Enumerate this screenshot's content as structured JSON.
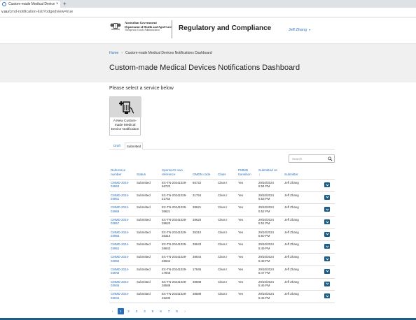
{
  "browser": {
    "tab_title": "Custom-made Medical Devices N",
    "tab_close": "×",
    "new_tab": "+",
    "url_prefix": "v.au",
    "url_path": "/cmd-notification-list/?odgedview=true"
  },
  "header": {
    "gov_line1": "Australian Government",
    "gov_line2": "Department of Health and Aged Care",
    "gov_line3": "Therapeutic Goods Administration",
    "site_title": "Regulatory and Compliance",
    "user_name": "Jeff Zhang",
    "user_caret": "▾"
  },
  "breadcrumb": {
    "home": "Home",
    "separator": "›",
    "current": "Custom-made Medical Devices Notifications Dashboard"
  },
  "page_title": "Custom-made Medical Devices Notifications Dashboard",
  "service": {
    "heading": "Please select a service below",
    "tile_label": "A New Custom-made Medical Device Notification"
  },
  "tabs": {
    "draft": "Draft",
    "submitted": "Submitted",
    "active": "Submitted"
  },
  "search": {
    "placeholder": "Search"
  },
  "table": {
    "headers": {
      "reference": "Reference number",
      "status": "Status",
      "sponsor_ref": "Sponsor's own reference",
      "gmdn": "GMDN code",
      "class": "Class",
      "pmmd": "PMMD transition",
      "submitted": "Submitted on",
      "sort_arrow": "↓",
      "submitter": "Submitter"
    },
    "rows": [
      {
        "ref_a": "CMMD-2024-",
        "ref_b": "03963",
        "status": "Submitted",
        "spon_a": "EX-TN-20241029-",
        "spon_b": "66722",
        "gmdn": "66722",
        "class": "Class I",
        "pmmd": "Yes",
        "date": "29/10/2024",
        "time": "5:54 PM",
        "submitter": "Jeff Zhang"
      },
      {
        "ref_a": "CMMD-2024-",
        "ref_b": "03961",
        "status": "Submitted",
        "spon_a": "EX-TN-20241029-",
        "spon_b": "31754",
        "gmdn": "31754",
        "class": "Class I",
        "pmmd": "Yes",
        "date": "29/10/2024",
        "time": "5:53 PM",
        "submitter": "Jeff Zhang"
      },
      {
        "ref_a": "CMMD-2024-",
        "ref_b": "03959",
        "status": "Submitted",
        "spon_a": "EX-TN-20241029-",
        "spon_b": "38621",
        "gmdn": "38621",
        "class": "Class I",
        "pmmd": "Yes",
        "date": "29/10/2024",
        "time": "5:52 PM",
        "submitter": "Jeff Zhang"
      },
      {
        "ref_a": "CMMD-2024-",
        "ref_b": "03957",
        "status": "Submitted",
        "spon_a": "EX-TN-20241029-",
        "spon_b": "38620",
        "gmdn": "38620",
        "class": "Class I",
        "pmmd": "Yes",
        "date": "29/10/2024",
        "time": "5:51 PM",
        "submitter": "Jeff Zhang"
      },
      {
        "ref_a": "CMMD-2024-",
        "ref_b": "03955",
        "status": "Submitted",
        "spon_a": "EX-TN-20241029-",
        "spon_b": "35310",
        "gmdn": "35310",
        "class": "Class I",
        "pmmd": "Yes",
        "date": "29/10/2024",
        "time": "5:50 PM",
        "submitter": "Jeff Zhang"
      },
      {
        "ref_a": "CMMD-2024-",
        "ref_b": "03952",
        "status": "Submitted",
        "spon_a": "EX-TN-20241029-",
        "spon_b": "38643",
        "gmdn": "38643",
        "class": "Class I",
        "pmmd": "Yes",
        "date": "29/10/2024",
        "time": "5:49 PM",
        "submitter": "Jeff Zhang"
      },
      {
        "ref_a": "CMMD-2024-",
        "ref_b": "03950",
        "status": "Submitted",
        "spon_a": "EX-TN-20241029-",
        "spon_b": "38644",
        "gmdn": "38644",
        "class": "Class I",
        "pmmd": "Yes",
        "date": "29/10/2024",
        "time": "5:48 PM",
        "submitter": "Jeff Zhang"
      },
      {
        "ref_a": "CMMD-2024-",
        "ref_b": "03948",
        "status": "Submitted",
        "spon_a": "EX-TN-20241029-",
        "spon_b": "17845",
        "gmdn": "17845",
        "class": "Class I",
        "pmmd": "Yes",
        "date": "29/10/2024",
        "time": "5:47 PM",
        "submitter": "Jeff Zhang"
      },
      {
        "ref_a": "CMMD-2024-",
        "ref_b": "03946",
        "status": "Submitted",
        "spon_a": "EX-TN-20241029-",
        "spon_b": "38588",
        "gmdn": "38588",
        "class": "Class I",
        "pmmd": "Yes",
        "date": "29/10/2024",
        "time": "5:46 PM",
        "submitter": "Jeff Zhang"
      },
      {
        "ref_a": "CMMD-2024-",
        "ref_b": "03944",
        "status": "Submitted",
        "spon_a": "EX-TN-20241029-",
        "spon_b": "45230",
        "gmdn": "38589",
        "class": "Class I",
        "pmmd": "Yes",
        "date": "29/10/2024",
        "time": "5:45 PM",
        "submitter": "Jeff Zhang"
      }
    ]
  },
  "pagination": {
    "prev": "‹",
    "pages": [
      "1",
      "2",
      "3",
      "4",
      "5",
      "6",
      "7",
      "8"
    ],
    "next": "›",
    "current": "1"
  },
  "colors": {
    "link": "#2a6ebb",
    "expand_button": "#1a5e8a",
    "banner": "#f0f0f0"
  }
}
